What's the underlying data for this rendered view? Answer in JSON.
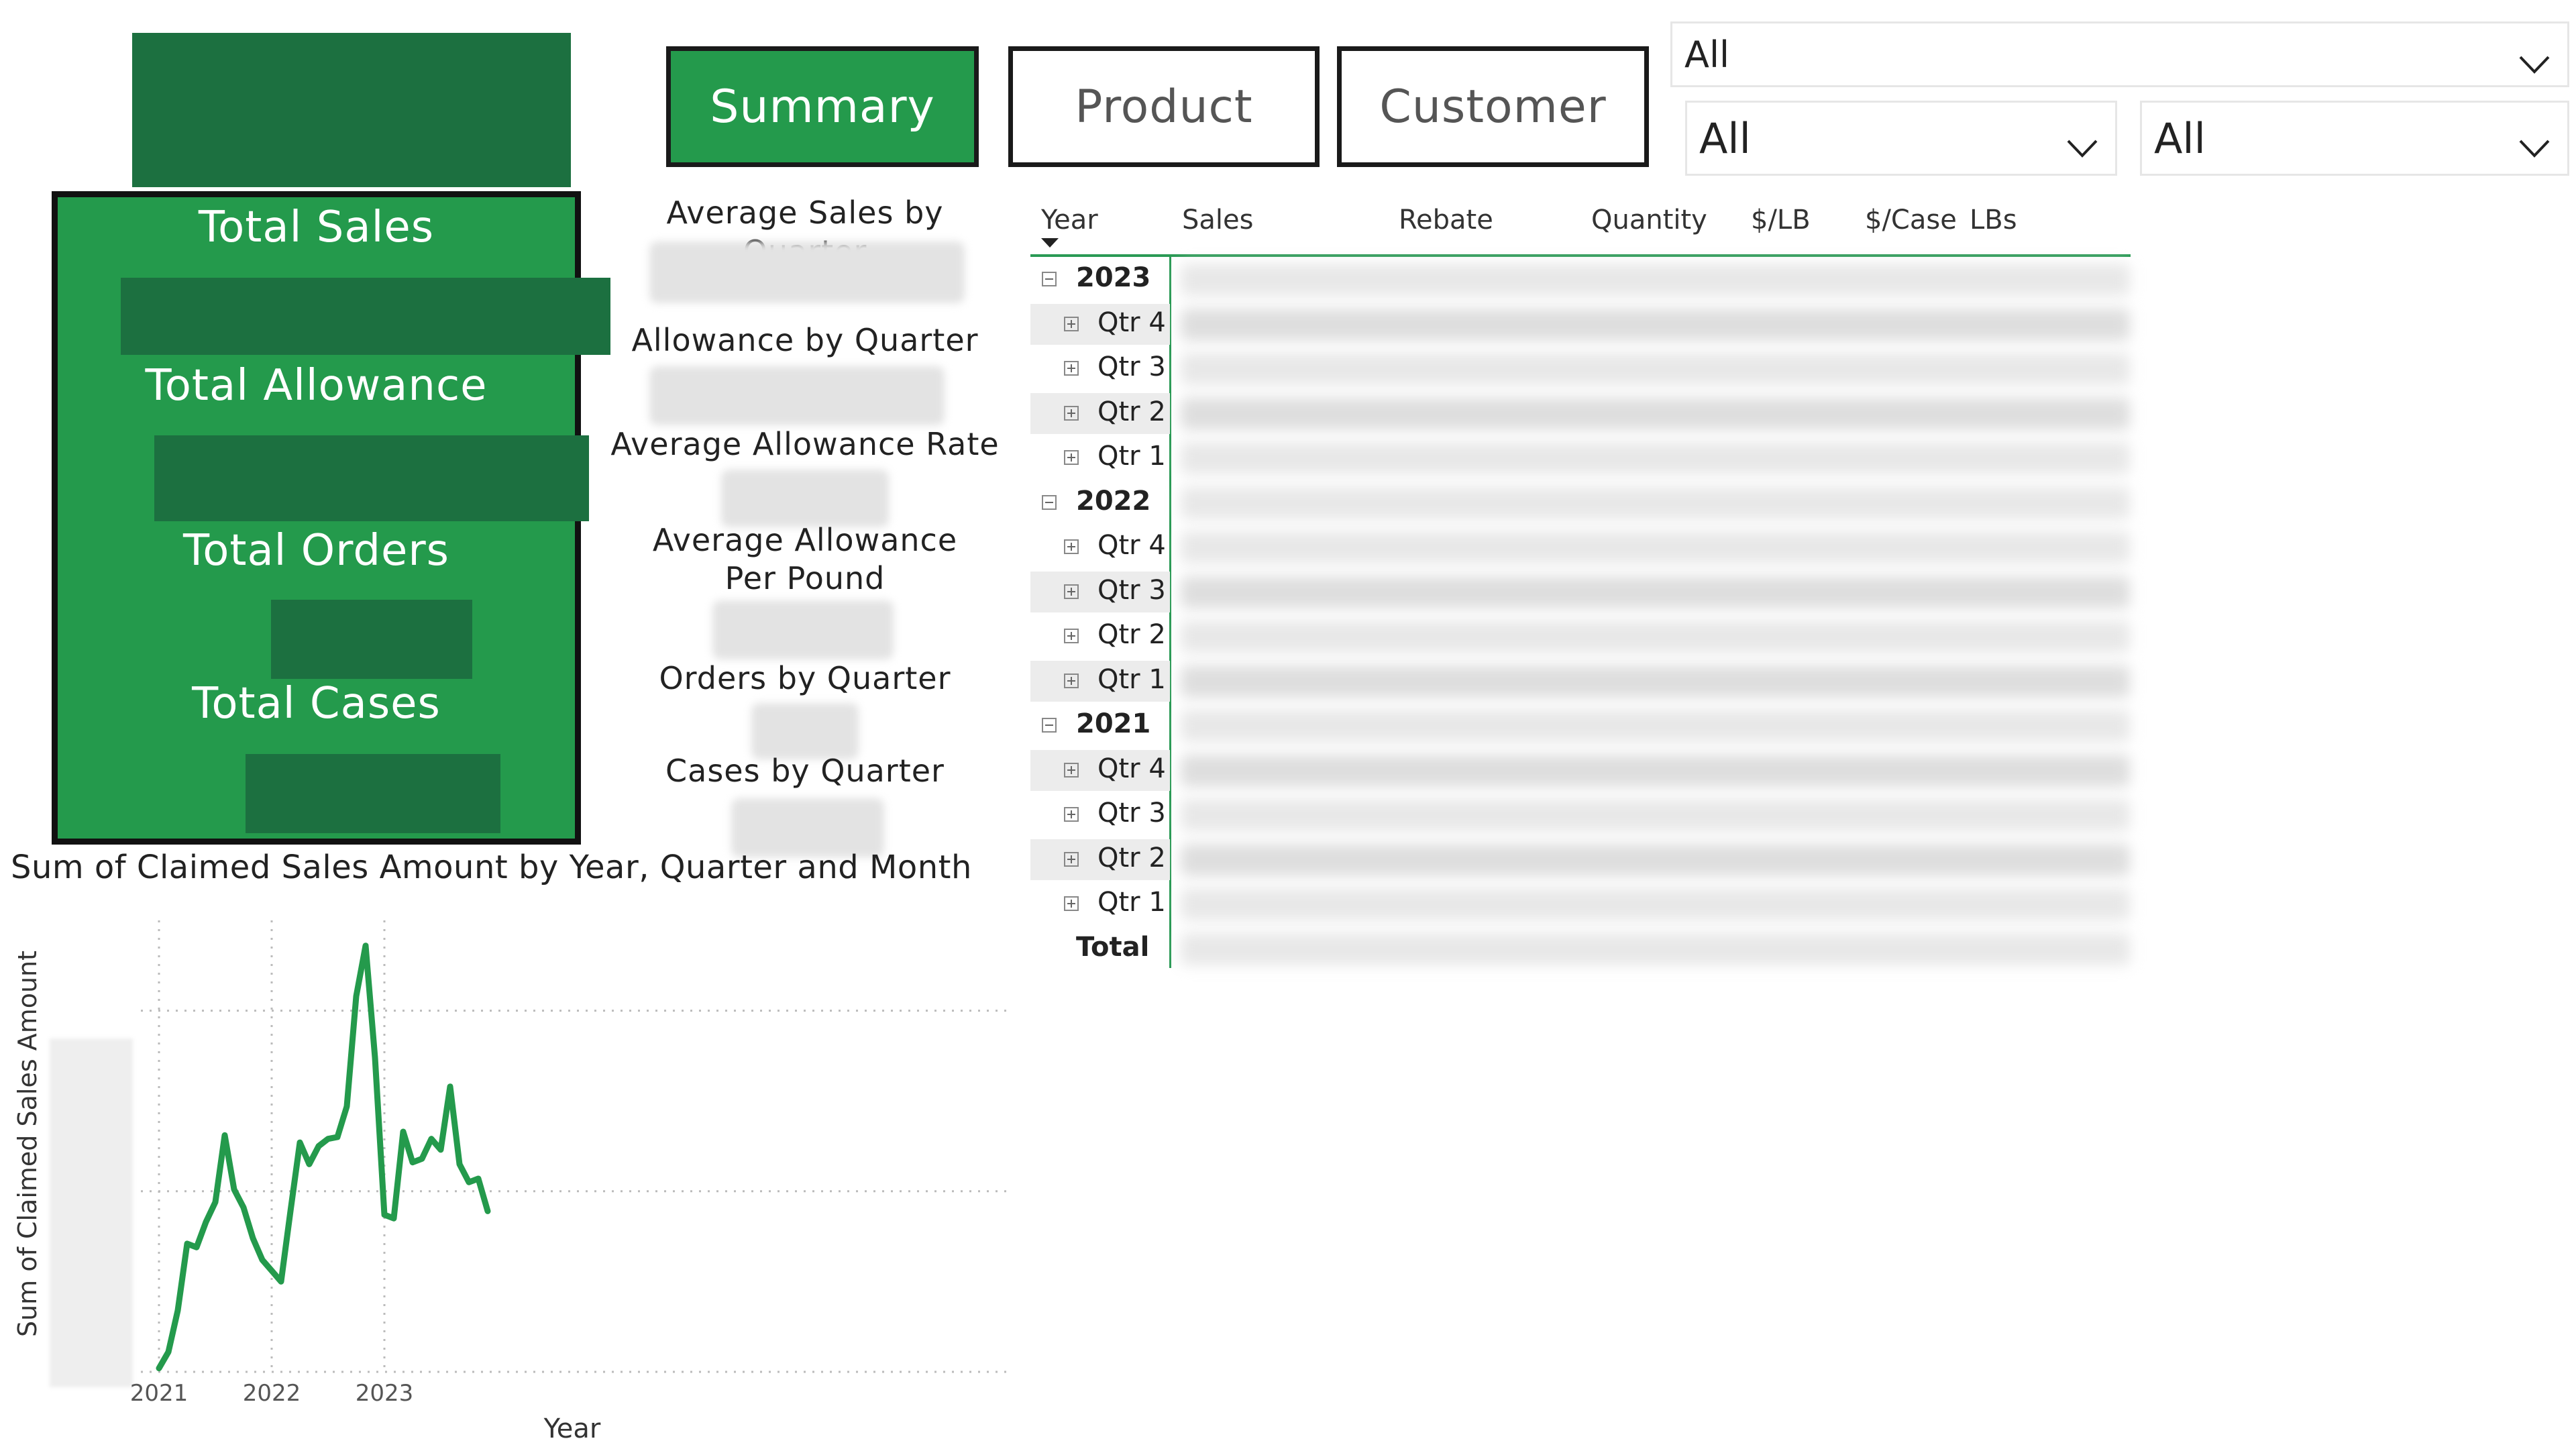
{
  "nav": {
    "summary": "Summary",
    "product": "Product",
    "customer": "Customer"
  },
  "slicers": {
    "top": "All",
    "left": "All",
    "right": "All"
  },
  "kpis": {
    "total_sales": "Total Sales",
    "total_allowance": "Total Allowance",
    "total_orders": "Total Orders",
    "total_cases": "Total Cases"
  },
  "quarter_kpis": {
    "avg_sales": "Average Sales by Quarter",
    "allowance": "Allowance by Quarter",
    "avg_allowance_rate": "Average Allowance Rate",
    "avg_allowance_per_pound_line1": "Average Allowance",
    "avg_allowance_per_pound_line2": "Per Pound",
    "orders": "Orders by Quarter",
    "cases": "Cases by Quarter"
  },
  "matrix": {
    "columns": [
      "Year",
      "Sales",
      "Rebate",
      "Quantity",
      "$/LB",
      "$/Case",
      "LBs"
    ],
    "rows": [
      {
        "label": "2023",
        "level": 0
      },
      {
        "label": "Qtr 4",
        "level": 1
      },
      {
        "label": "Qtr 3",
        "level": 1
      },
      {
        "label": "Qtr 2",
        "level": 1
      },
      {
        "label": "Qtr 1",
        "level": 1
      },
      {
        "label": "2022",
        "level": 0
      },
      {
        "label": "Qtr 4",
        "level": 1
      },
      {
        "label": "Qtr 3",
        "level": 1
      },
      {
        "label": "Qtr 2",
        "level": 1
      },
      {
        "label": "Qtr 1",
        "level": 1
      },
      {
        "label": "2021",
        "level": 0
      },
      {
        "label": "Qtr 4",
        "level": 1
      },
      {
        "label": "Qtr 3",
        "level": 1
      },
      {
        "label": "Qtr 2",
        "level": 1
      },
      {
        "label": "Qtr 1",
        "level": 1
      },
      {
        "label": "Total",
        "level": 2
      }
    ]
  },
  "chart_data": {
    "type": "line",
    "title": "Sum of Claimed Sales Amount by Year, Quarter and Month",
    "xlabel": "Year",
    "ylabel": "Sum of Claimed Sales Amount",
    "x_ticks": [
      "2021",
      "2022",
      "2023"
    ],
    "grid": true,
    "color": "#249a4c",
    "series": [
      {
        "values": [
          2,
          11,
          34,
          71,
          69,
          83,
          94,
          131,
          101,
          91,
          74,
          62,
          56,
          50,
          89,
          127,
          115,
          125,
          129,
          130,
          147,
          208,
          236,
          174,
          87,
          85,
          133,
          116,
          118,
          129,
          123,
          158,
          115,
          105,
          107,
          89
        ]
      }
    ]
  }
}
